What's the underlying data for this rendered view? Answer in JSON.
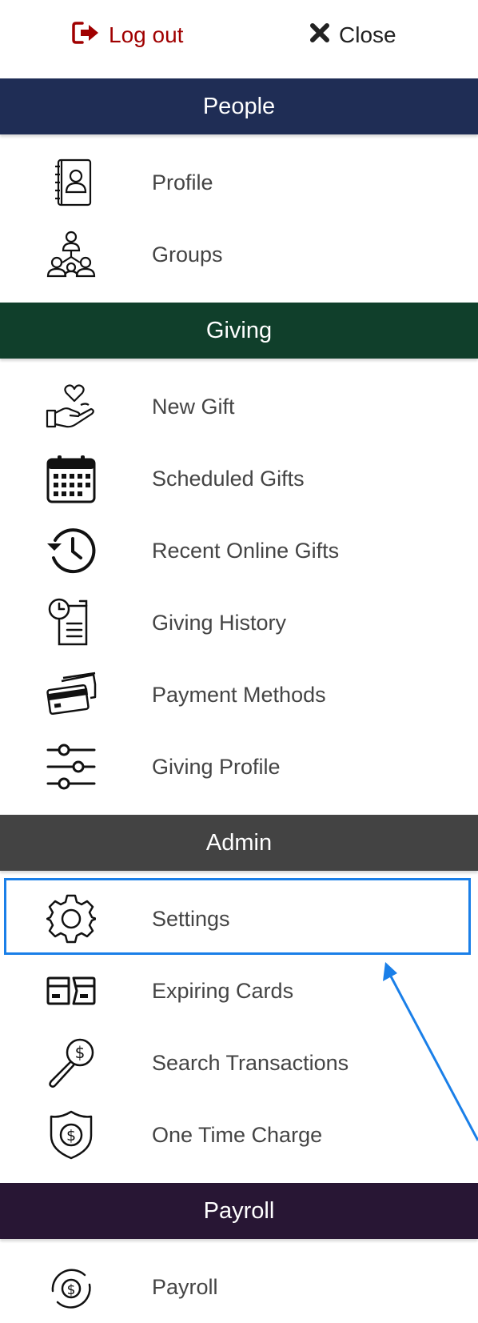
{
  "topbar": {
    "logout_label": "Log out",
    "close_label": "Close",
    "logout_color": "#a00000"
  },
  "sections": [
    {
      "title": "People",
      "color": "#1f2d55",
      "items": [
        {
          "label": "Profile",
          "icon": "address-book-icon"
        },
        {
          "label": "Groups",
          "icon": "group-hierarchy-icon"
        }
      ]
    },
    {
      "title": "Giving",
      "color": "#103f2b",
      "items": [
        {
          "label": "New Gift",
          "icon": "hand-heart-icon"
        },
        {
          "label": "Scheduled Gifts",
          "icon": "calendar-icon"
        },
        {
          "label": "Recent Online Gifts",
          "icon": "history-clock-icon"
        },
        {
          "label": "Giving History",
          "icon": "document-clock-icon"
        },
        {
          "label": "Payment Methods",
          "icon": "credit-cards-icon"
        },
        {
          "label": "Giving Profile",
          "icon": "sliders-icon"
        }
      ]
    },
    {
      "title": "Admin",
      "color": "#434343",
      "items": [
        {
          "label": "Settings",
          "icon": "gear-icon",
          "highlighted": true
        },
        {
          "label": "Expiring Cards",
          "icon": "cards-icon"
        },
        {
          "label": "Search Transactions",
          "icon": "magnifier-dollar-icon"
        },
        {
          "label": "One Time Charge",
          "icon": "shield-dollar-icon"
        }
      ]
    },
    {
      "title": "Payroll",
      "color": "#281634",
      "items": [
        {
          "label": "Payroll",
          "icon": "payroll-cycle-icon"
        }
      ]
    }
  ],
  "annotation": {
    "highlight_color": "#1a7fe8"
  }
}
